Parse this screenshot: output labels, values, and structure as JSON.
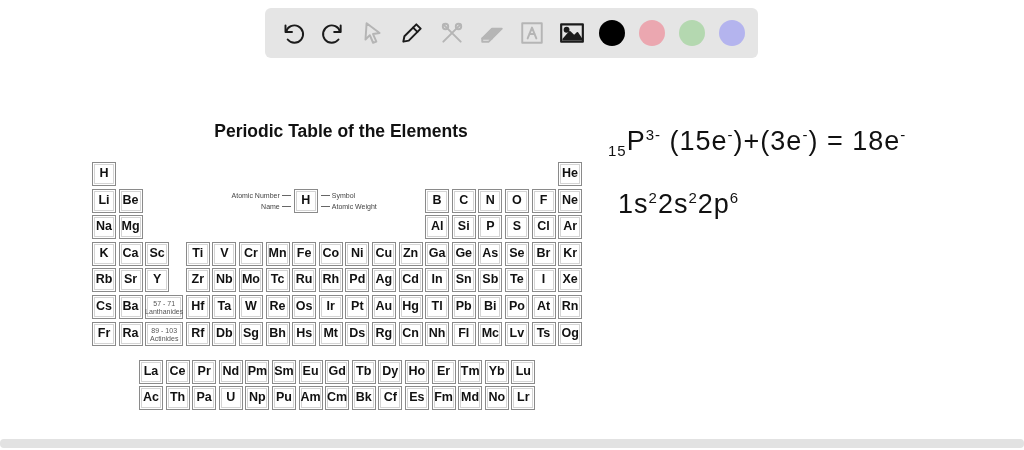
{
  "toolbar": {
    "tools": [
      {
        "kind": "undo",
        "disabled": false
      },
      {
        "kind": "redo",
        "disabled": false
      },
      {
        "kind": "select",
        "disabled": true
      },
      {
        "kind": "pen",
        "disabled": false
      },
      {
        "kind": "tools",
        "disabled": true
      },
      {
        "kind": "eraser",
        "disabled": true
      },
      {
        "kind": "text",
        "disabled": true
      },
      {
        "kind": "image",
        "disabled": false
      }
    ],
    "colors": [
      {
        "color": "#000000"
      },
      {
        "color": "#eba7b0"
      },
      {
        "color": "#b4d8b0"
      },
      {
        "color": "#b4b4ee"
      }
    ]
  },
  "periodic_table": {
    "title": "Periodic Table of the Elements",
    "legend": {
      "symbol": "H",
      "labels": {
        "atomic_number": "Atomic Number",
        "name": "Name",
        "symbol": "Symbol",
        "atomic_weight": "Atomic Weight"
      }
    },
    "rows": [
      [
        {
          "kind": "element",
          "symbol": "H"
        },
        null,
        null,
        null,
        null,
        null,
        null,
        null,
        null,
        null,
        null,
        null,
        null,
        null,
        null,
        null,
        null,
        {
          "kind": "element",
          "symbol": "He"
        }
      ],
      [
        {
          "kind": "element",
          "symbol": "Li"
        },
        {
          "kind": "element",
          "symbol": "Be"
        },
        null,
        null,
        null,
        null,
        null,
        null,
        null,
        null,
        null,
        null,
        {
          "kind": "element",
          "symbol": "B"
        },
        {
          "kind": "element",
          "symbol": "C"
        },
        {
          "kind": "element",
          "symbol": "N"
        },
        {
          "kind": "element",
          "symbol": "O"
        },
        {
          "kind": "element",
          "symbol": "F"
        },
        {
          "kind": "element",
          "symbol": "Ne"
        }
      ],
      [
        {
          "kind": "element",
          "symbol": "Na"
        },
        {
          "kind": "element",
          "symbol": "Mg"
        },
        null,
        null,
        null,
        null,
        null,
        null,
        null,
        null,
        null,
        null,
        {
          "kind": "element",
          "symbol": "Al"
        },
        {
          "kind": "element",
          "symbol": "Si"
        },
        {
          "kind": "element",
          "symbol": "P"
        },
        {
          "kind": "element",
          "symbol": "S"
        },
        {
          "kind": "element",
          "symbol": "Cl"
        },
        {
          "kind": "element",
          "symbol": "Ar"
        }
      ],
      [
        {
          "kind": "element",
          "symbol": "K"
        },
        {
          "kind": "element",
          "symbol": "Ca"
        },
        {
          "kind": "element",
          "symbol": "Sc"
        },
        {
          "kind": "element",
          "symbol": "Ti"
        },
        {
          "kind": "element",
          "symbol": "V"
        },
        {
          "kind": "element",
          "symbol": "Cr"
        },
        {
          "kind": "element",
          "symbol": "Mn"
        },
        {
          "kind": "element",
          "symbol": "Fe"
        },
        {
          "kind": "element",
          "symbol": "Co"
        },
        {
          "kind": "element",
          "symbol": "Ni"
        },
        {
          "kind": "element",
          "symbol": "Cu"
        },
        {
          "kind": "element",
          "symbol": "Zn"
        },
        {
          "kind": "element",
          "symbol": "Ga"
        },
        {
          "kind": "element",
          "symbol": "Ge"
        },
        {
          "kind": "element",
          "symbol": "As"
        },
        {
          "kind": "element",
          "symbol": "Se"
        },
        {
          "kind": "element",
          "symbol": "Br"
        },
        {
          "kind": "element",
          "symbol": "Kr"
        }
      ],
      [
        {
          "kind": "element",
          "symbol": "Rb"
        },
        {
          "kind": "element",
          "symbol": "Sr"
        },
        {
          "kind": "element",
          "symbol": "Y"
        },
        {
          "kind": "element",
          "symbol": "Zr"
        },
        {
          "kind": "element",
          "symbol": "Nb"
        },
        {
          "kind": "element",
          "symbol": "Mo"
        },
        {
          "kind": "element",
          "symbol": "Tc"
        },
        {
          "kind": "element",
          "symbol": "Ru"
        },
        {
          "kind": "element",
          "symbol": "Rh"
        },
        {
          "kind": "element",
          "symbol": "Pd"
        },
        {
          "kind": "element",
          "symbol": "Ag"
        },
        {
          "kind": "element",
          "symbol": "Cd"
        },
        {
          "kind": "element",
          "symbol": "In"
        },
        {
          "kind": "element",
          "symbol": "Sn"
        },
        {
          "kind": "element",
          "symbol": "Sb"
        },
        {
          "kind": "element",
          "symbol": "Te"
        },
        {
          "kind": "element",
          "symbol": "I"
        },
        {
          "kind": "element",
          "symbol": "Xe"
        }
      ],
      [
        {
          "kind": "element",
          "symbol": "Cs"
        },
        {
          "kind": "element",
          "symbol": "Ba"
        },
        {
          "kind": "series",
          "range": "57 - 71",
          "label": "Lanthanides"
        },
        {
          "kind": "element",
          "symbol": "Hf"
        },
        {
          "kind": "element",
          "symbol": "Ta"
        },
        {
          "kind": "element",
          "symbol": "W"
        },
        {
          "kind": "element",
          "symbol": "Re"
        },
        {
          "kind": "element",
          "symbol": "Os"
        },
        {
          "kind": "element",
          "symbol": "Ir"
        },
        {
          "kind": "element",
          "symbol": "Pt"
        },
        {
          "kind": "element",
          "symbol": "Au"
        },
        {
          "kind": "element",
          "symbol": "Hg"
        },
        {
          "kind": "element",
          "symbol": "Tl"
        },
        {
          "kind": "element",
          "symbol": "Pb"
        },
        {
          "kind": "element",
          "symbol": "Bi"
        },
        {
          "kind": "element",
          "symbol": "Po"
        },
        {
          "kind": "element",
          "symbol": "At"
        },
        {
          "kind": "element",
          "symbol": "Rn"
        }
      ],
      [
        {
          "kind": "element",
          "symbol": "Fr"
        },
        {
          "kind": "element",
          "symbol": "Ra"
        },
        {
          "kind": "series",
          "range": "89 - 103",
          "label": "Actinides"
        },
        {
          "kind": "element",
          "symbol": "Rf"
        },
        {
          "kind": "element",
          "symbol": "Db"
        },
        {
          "kind": "element",
          "symbol": "Sg"
        },
        {
          "kind": "element",
          "symbol": "Bh"
        },
        {
          "kind": "element",
          "symbol": "Hs"
        },
        {
          "kind": "element",
          "symbol": "Mt"
        },
        {
          "kind": "element",
          "symbol": "Ds"
        },
        {
          "kind": "element",
          "symbol": "Rg"
        },
        {
          "kind": "element",
          "symbol": "Cn"
        },
        {
          "kind": "element",
          "symbol": "Nh"
        },
        {
          "kind": "element",
          "symbol": "Fl"
        },
        {
          "kind": "element",
          "symbol": "Mc"
        },
        {
          "kind": "element",
          "symbol": "Lv"
        },
        {
          "kind": "element",
          "symbol": "Ts"
        },
        {
          "kind": "element",
          "symbol": "Og"
        }
      ]
    ],
    "series_rows": [
      [
        "La",
        "Ce",
        "Pr",
        "Nd",
        "Pm",
        "Sm",
        "Eu",
        "Gd",
        "Tb",
        "Dy",
        "Ho",
        "Er",
        "Tm",
        "Yb",
        "Lu"
      ],
      [
        "Ac",
        "Th",
        "Pa",
        "U",
        "Np",
        "Pu",
        "Am",
        "Cm",
        "Bk",
        "Cf",
        "Es",
        "Fm",
        "Md",
        "No",
        "Lr"
      ]
    ]
  },
  "notes": [
    "$_{15}$P$^{3-}$ (15e$^{-}$)+(3e$^{-}$) = 18e$^{-}$",
    "1s$^{2}$2s$^{2}$2p$^{6}$"
  ]
}
